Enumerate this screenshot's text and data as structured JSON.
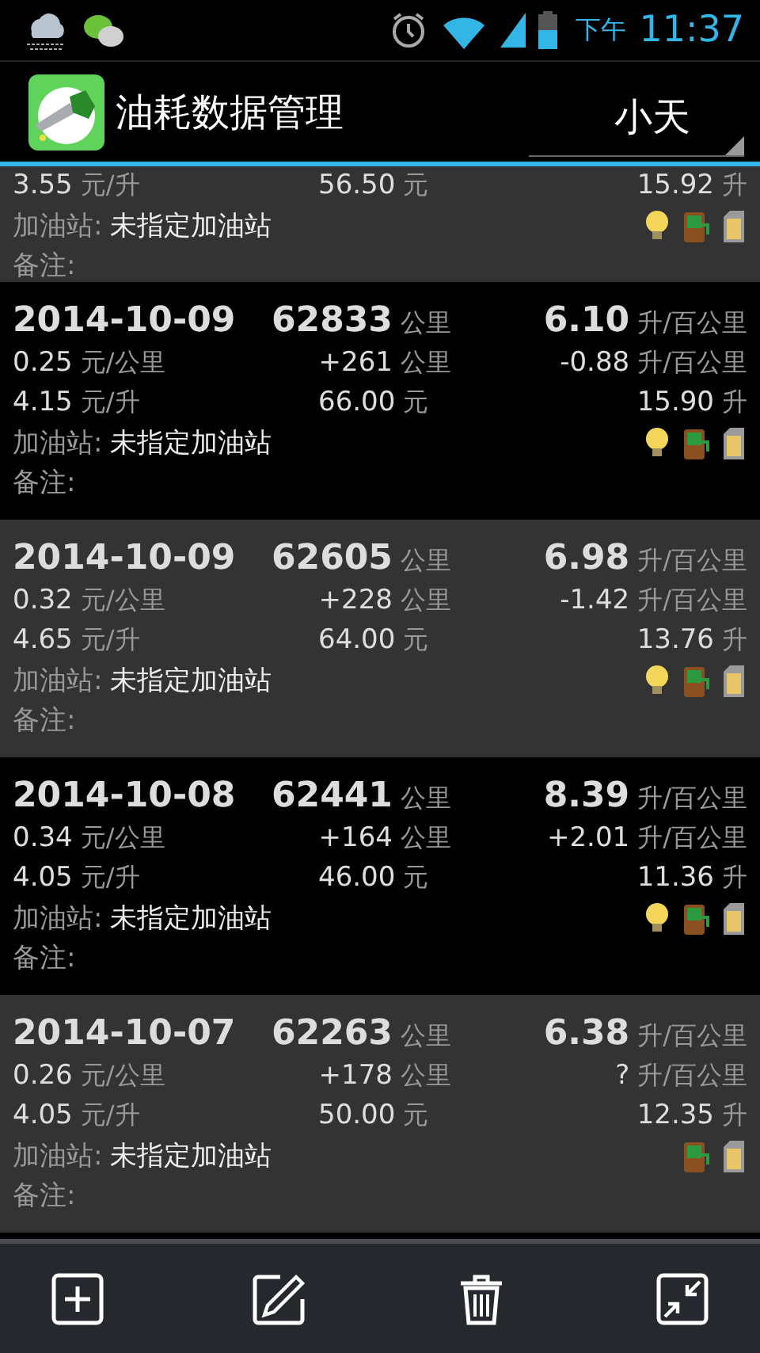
{
  "status_bar": {
    "period": "下午",
    "time": "11:37"
  },
  "app_bar": {
    "title": "油耗数据管理",
    "spinner": {
      "value": "小天"
    }
  },
  "records": [
    {
      "price": "3.55",
      "price_unit": "元/升",
      "amount": "56.50",
      "amount_unit": "元",
      "volume": "15.92",
      "volume_unit": "升",
      "station_label": "加油站:",
      "station": "未指定加油站",
      "note_label": "备注:",
      "indicators": [
        {
          "kind": "bulb"
        },
        {
          "kind": "pump"
        },
        {
          "kind": "can"
        }
      ]
    },
    {
      "date": "2014-10-09",
      "odometer": "62833",
      "odometer_unit": "公里",
      "consumption": "6.10",
      "consumption_unit": "升/百公里",
      "cost_per_km": "0.25",
      "cost_per_km_unit": "元/公里",
      "distance": "+261",
      "distance_unit": "公里",
      "consumption_change": "-0.88",
      "consumption_change_unit": "升/百公里",
      "price": "4.15",
      "price_unit": "元/升",
      "amount": "66.00",
      "amount_unit": "元",
      "volume": "15.90",
      "volume_unit": "升",
      "station_label": "加油站:",
      "station": "未指定加油站",
      "note_label": "备注:",
      "indicators": [
        {
          "kind": "bulb"
        },
        {
          "kind": "pump"
        },
        {
          "kind": "can"
        }
      ]
    },
    {
      "date": "2014-10-09",
      "odometer": "62605",
      "odometer_unit": "公里",
      "consumption": "6.98",
      "consumption_unit": "升/百公里",
      "cost_per_km": "0.32",
      "cost_per_km_unit": "元/公里",
      "distance": "+228",
      "distance_unit": "公里",
      "consumption_change": "-1.42",
      "consumption_change_unit": "升/百公里",
      "price": "4.65",
      "price_unit": "元/升",
      "amount": "64.00",
      "amount_unit": "元",
      "volume": "13.76",
      "volume_unit": "升",
      "station_label": "加油站:",
      "station": "未指定加油站",
      "note_label": "备注:",
      "indicators": [
        {
          "kind": "bulb"
        },
        {
          "kind": "pump"
        },
        {
          "kind": "can"
        }
      ]
    },
    {
      "date": "2014-10-08",
      "odometer": "62441",
      "odometer_unit": "公里",
      "consumption": "8.39",
      "consumption_unit": "升/百公里",
      "cost_per_km": "0.34",
      "cost_per_km_unit": "元/公里",
      "distance": "+164",
      "distance_unit": "公里",
      "consumption_change": "+2.01",
      "consumption_change_unit": "升/百公里",
      "price": "4.05",
      "price_unit": "元/升",
      "amount": "46.00",
      "amount_unit": "元",
      "volume": "11.36",
      "volume_unit": "升",
      "station_label": "加油站:",
      "station": "未指定加油站",
      "note_label": "备注:",
      "indicators": [
        {
          "kind": "bulb"
        },
        {
          "kind": "pump"
        },
        {
          "kind": "can"
        }
      ]
    },
    {
      "date": "2014-10-07",
      "odometer": "62263",
      "odometer_unit": "公里",
      "consumption": "6.38",
      "consumption_unit": "升/百公里",
      "cost_per_km": "0.26",
      "cost_per_km_unit": "元/公里",
      "distance": "+178",
      "distance_unit": "公里",
      "consumption_change": "?",
      "consumption_change_unit": "升/百公里",
      "price": "4.05",
      "price_unit": "元/升",
      "amount": "50.00",
      "amount_unit": "元",
      "volume": "12.35",
      "volume_unit": "升",
      "station_label": "加油站:",
      "station": "未指定加油站",
      "note_label": "备注:",
      "indicators": [
        {
          "kind": "pump"
        },
        {
          "kind": "can"
        }
      ]
    }
  ],
  "toolbar": {
    "buttons": [
      {
        "kind": "add"
      },
      {
        "kind": "edit"
      },
      {
        "kind": "delete"
      },
      {
        "kind": "collapse"
      }
    ]
  }
}
